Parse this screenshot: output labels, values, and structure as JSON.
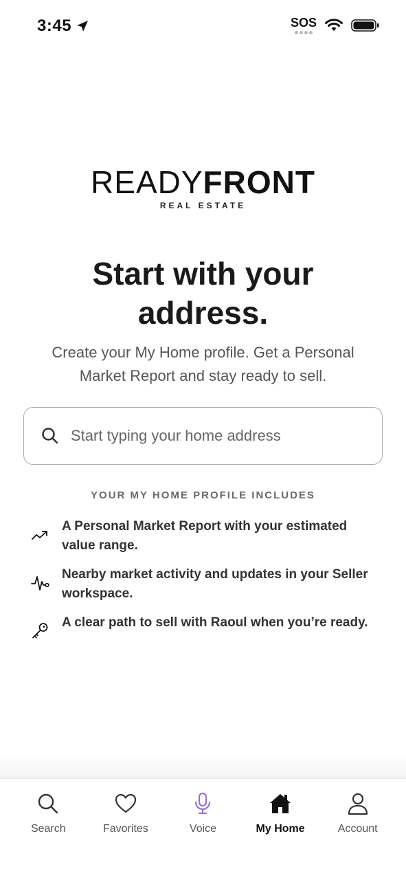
{
  "status_bar": {
    "time": "3:45",
    "sos": "SOS"
  },
  "logo": {
    "light": "READY",
    "bold": "FRONT",
    "sub": "REAL ESTATE"
  },
  "headline": "Start with your address.",
  "subtitle": "Create your My Home profile. Get a Personal Market Report and stay ready to sell.",
  "search": {
    "placeholder": "Start typing your home address",
    "value": ""
  },
  "includes": {
    "title": "YOUR MY HOME PROFILE INCLUDES",
    "items": [
      {
        "icon": "trend-up-icon",
        "text": "A Personal Market Report with your estimated value range."
      },
      {
        "icon": "activity-pulse-icon",
        "text": "Nearby market activity and updates in your Seller workspace."
      },
      {
        "icon": "key-icon",
        "text": "A clear path to sell with Raoul when you’re ready."
      }
    ]
  },
  "tab_bar": {
    "items": [
      {
        "label": "Search",
        "icon": "search-icon",
        "active": false
      },
      {
        "label": "Favorites",
        "icon": "heart-icon",
        "active": false
      },
      {
        "label": "Voice",
        "icon": "microphone-icon",
        "active": false
      },
      {
        "label": "My Home",
        "icon": "home-icon",
        "active": true
      },
      {
        "label": "Account",
        "icon": "user-icon",
        "active": false
      }
    ]
  },
  "colors": {
    "voice_accent": "#9b6fd6",
    "text_primary": "#1a1a1a",
    "muted_label": "#6e6763"
  }
}
